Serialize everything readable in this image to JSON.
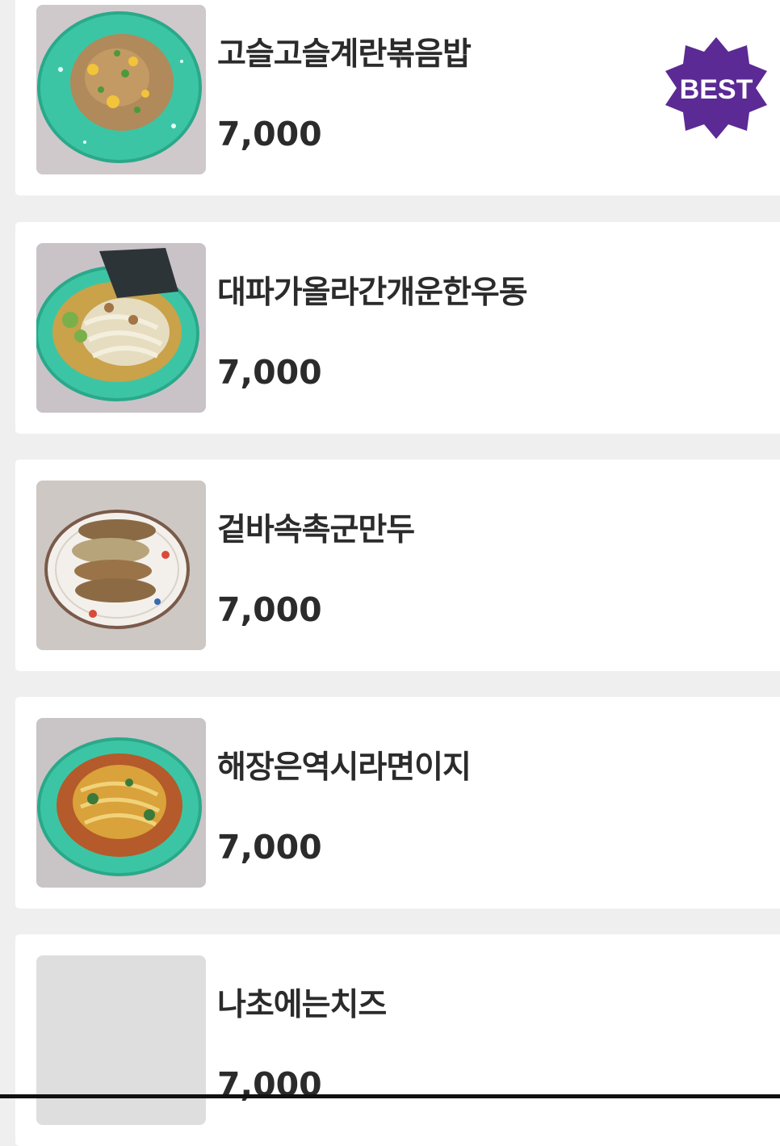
{
  "menu": {
    "items": [
      {
        "name": "고슬고슬계란볶음밥",
        "price": "7,000",
        "badge": "BEST",
        "image": "fried-rice-photo"
      },
      {
        "name": "대파가올라간개운한우동",
        "price": "7,000",
        "image": "udon-photo"
      },
      {
        "name": "겉바속촉군만두",
        "price": "7,000",
        "image": "fried-dumplings-photo"
      },
      {
        "name": "해장은역시라면이지",
        "price": "7,000",
        "image": "ramen-photo"
      },
      {
        "name": "나초에는치즈",
        "price": "7,000",
        "image": "image-placeholder"
      }
    ]
  },
  "colors": {
    "badge": "#5b2a94",
    "background": "#efefef",
    "card": "#ffffff",
    "text": "#2b2b2b",
    "bowl": "#3cc5a4"
  }
}
